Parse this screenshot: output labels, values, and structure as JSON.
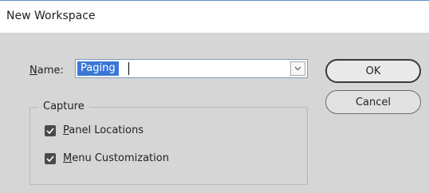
{
  "window": {
    "title": "New Workspace"
  },
  "name_field": {
    "label_mnemonic": "N",
    "label_rest": "ame:",
    "value": "Paging"
  },
  "buttons": {
    "ok": "OK",
    "cancel": "Cancel"
  },
  "capture": {
    "legend": "Capture",
    "panel_locations": {
      "mnemonic": "P",
      "rest": "anel Locations",
      "checked": true
    },
    "menu_customization": {
      "mnemonic": "M",
      "rest": "enu Customization",
      "checked": true
    }
  },
  "colors": {
    "selection": "#3b78d6",
    "background": "#d6d6d6",
    "titlebar": "#ffffff"
  }
}
